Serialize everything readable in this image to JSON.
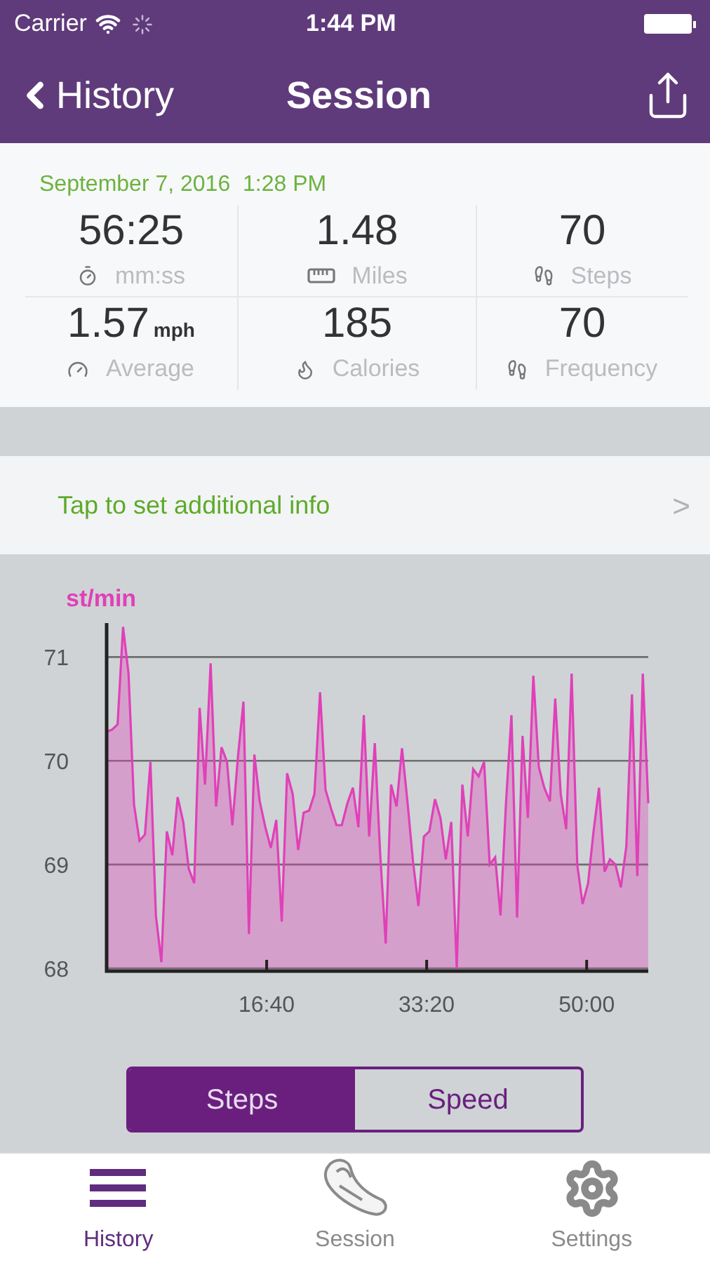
{
  "status_bar": {
    "carrier": "Carrier",
    "time": "1:44 PM"
  },
  "nav": {
    "back": "History",
    "title": "Session"
  },
  "session": {
    "date": "September 7, 2016  1:28 PM",
    "stats": [
      {
        "kind": "stopwatch",
        "value": "56:25",
        "label": "mm:ss"
      },
      {
        "kind": "ruler",
        "value": "1.48",
        "label": "Miles"
      },
      {
        "kind": "footprints",
        "value": "70",
        "label": "Steps"
      },
      {
        "kind": "gauge",
        "value": "1.57",
        "unit": "mph",
        "label": "Average"
      },
      {
        "kind": "flame",
        "value": "185",
        "label": "Calories"
      },
      {
        "kind": "footprints",
        "value": "70",
        "label": "Frequency"
      }
    ]
  },
  "info_row": {
    "label": "Tap to set additional info",
    "chevron": ">"
  },
  "chart": {
    "unit": "st/min",
    "chart_data": {
      "type": "area",
      "grid": true,
      "xlim": [
        0,
        3385
      ],
      "ylim": [
        68,
        71.3
      ],
      "x": [
        0,
        34,
        68,
        103,
        137,
        171,
        205,
        239,
        274,
        308,
        342,
        376,
        410,
        444,
        479,
        513,
        547,
        581,
        615,
        650,
        684,
        718,
        752,
        786,
        821,
        855,
        889,
        923,
        957,
        992,
        1026,
        1060,
        1094,
        1128,
        1163,
        1197,
        1231,
        1265,
        1299,
        1334,
        1368,
        1402,
        1436,
        1470,
        1505,
        1539,
        1573,
        1607,
        1641,
        1676,
        1710,
        1744,
        1778,
        1812,
        1846,
        1881,
        1915,
        1949,
        1983,
        2017,
        2052,
        2086,
        2120,
        2154,
        2188,
        2223,
        2257,
        2291,
        2325,
        2359,
        2394,
        2428,
        2462,
        2496,
        2530,
        2565,
        2599,
        2633,
        2667,
        2701,
        2735,
        2770,
        2804,
        2838,
        2872,
        2906,
        2941,
        2975,
        3009,
        3043,
        3077,
        3112,
        3146,
        3180,
        3214,
        3248,
        3283,
        3317,
        3351,
        3385
      ],
      "xticks": [
        {
          "value": 1000,
          "label": "16:40"
        },
        {
          "value": 2000,
          "label": "33:20"
        },
        {
          "value": 3000,
          "label": "50:00"
        }
      ],
      "yticks": [
        68,
        69,
        70,
        71
      ],
      "series": [
        {
          "color": "#e040b8",
          "values": [
            70.28,
            70.3,
            70.35,
            71.29,
            70.84,
            69.58,
            69.23,
            69.29,
            69.99,
            68.51,
            68.06,
            69.32,
            69.09,
            69.65,
            69.41,
            68.96,
            68.82,
            70.51,
            69.77,
            70.94,
            69.56,
            70.13,
            69.99,
            69.38,
            70.04,
            70.57,
            68.33,
            70.06,
            69.61,
            69.36,
            69.16,
            69.43,
            68.45,
            69.88,
            69.68,
            69.14,
            69.5,
            69.52,
            69.68,
            70.66,
            69.72,
            69.54,
            69.38,
            69.38,
            69.59,
            69.74,
            69.36,
            70.44,
            69.27,
            70.17,
            69.09,
            68.24,
            69.77,
            69.56,
            70.12,
            69.59,
            69.02,
            68.6,
            69.27,
            69.32,
            69.63,
            69.45,
            69.05,
            69.41,
            68.0,
            69.77,
            69.27,
            69.92,
            69.85,
            69.99,
            69.0,
            69.07,
            68.51,
            69.59,
            70.44,
            68.49,
            70.24,
            69.45,
            70.82,
            69.94,
            69.74,
            69.61,
            70.6,
            69.68,
            69.34,
            70.84,
            69.0,
            68.62,
            68.82,
            69.32,
            69.74,
            68.93,
            69.05,
            69.0,
            68.78,
            69.18,
            70.64,
            68.89,
            70.84,
            69.59
          ]
        }
      ]
    }
  },
  "segments": [
    {
      "label": "Steps",
      "selected": true
    },
    {
      "label": "Speed",
      "selected": false
    }
  ],
  "tab_bar": [
    {
      "kind": "list",
      "label": "History",
      "selected": true
    },
    {
      "kind": "shoe",
      "label": "Session",
      "selected": false
    },
    {
      "kind": "gear",
      "label": "Settings",
      "selected": false
    }
  ]
}
